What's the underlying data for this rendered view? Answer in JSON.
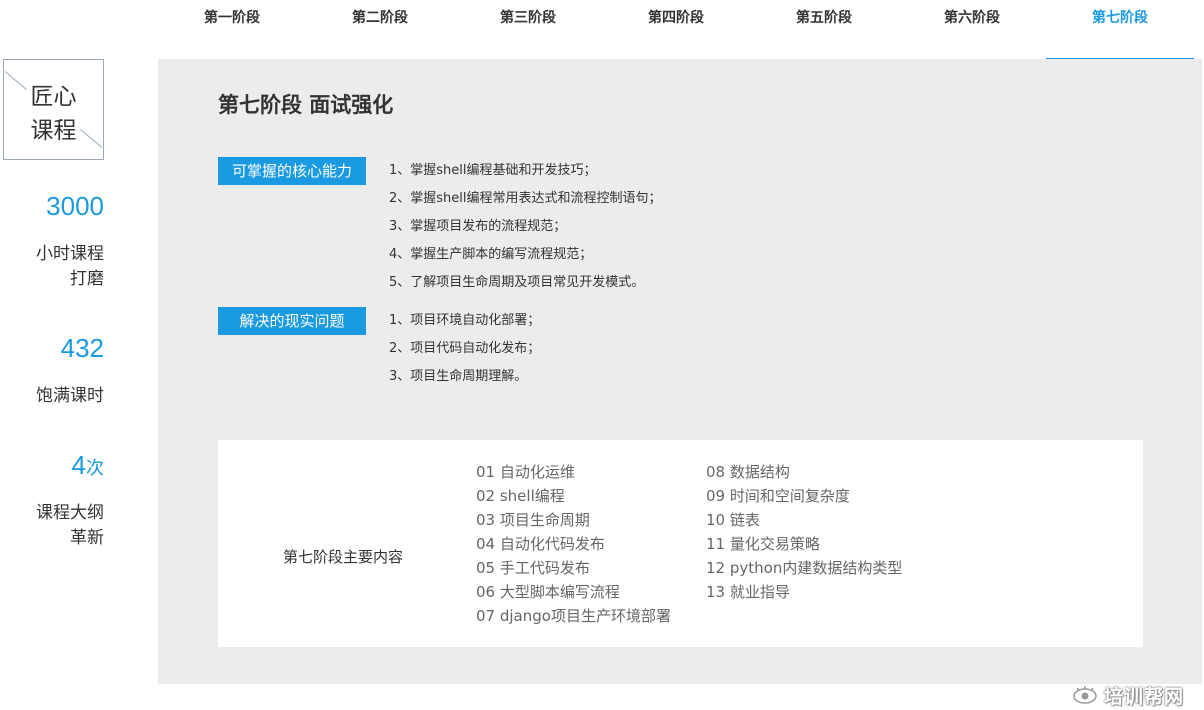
{
  "tabs": [
    {
      "label": "第一阶段"
    },
    {
      "label": "第二阶段"
    },
    {
      "label": "第三阶段"
    },
    {
      "label": "第四阶段"
    },
    {
      "label": "第五阶段"
    },
    {
      "label": "第六阶段"
    },
    {
      "label": "第七阶段"
    }
  ],
  "active_tab": "第七阶段",
  "sidebar": {
    "logo_line1": "匠心",
    "logo_line2": "课程",
    "stats": [
      {
        "number": "3000",
        "unit": "",
        "label_line1": "小时课程",
        "label_line2": "打磨"
      },
      {
        "number": "432",
        "unit": "",
        "label_line1": "饱满课时",
        "label_line2": ""
      },
      {
        "number": "4",
        "unit": "次",
        "label_line1": "课程大纲",
        "label_line2": "革新"
      }
    ]
  },
  "panel": {
    "title": "第七阶段 面试强化",
    "core_tag": "可掌握的核心能力",
    "core_items": [
      "1、掌握shell编程基础和开发技巧；",
      "2、掌握shell编程常用表达式和流程控制语句；",
      "3、掌握项目发布的流程规范；",
      "4、掌握生产脚本的编写流程规范；",
      "5、了解项目生命周期及项目常见开发模式。"
    ],
    "problem_tag": "解决的现实问题",
    "problem_items": [
      "1、项目环境自动化部署；",
      "2、项目代码自动化发布；",
      "3、项目生命周期理解。"
    ],
    "content_label": "第七阶段主要内容",
    "content_col1": [
      "01 自动化运维",
      "02 shell编程",
      "03 项目生命周期",
      "04 自动化代码发布",
      "05 手工代码发布",
      "06 大型脚本编写流程",
      "07 django项目生产环境部署"
    ],
    "content_col2": [
      "08 数据结构",
      "09 时间和空间复杂度",
      "10 链表",
      "11 量化交易策略",
      "12 python内建数据结构类型",
      "13 就业指导"
    ]
  },
  "watermark": {
    "text": "培训帮网",
    "icon": "eye-logo-icon"
  },
  "colors": {
    "accent": "#1a9ae0",
    "panel_bg": "#ececec"
  }
}
